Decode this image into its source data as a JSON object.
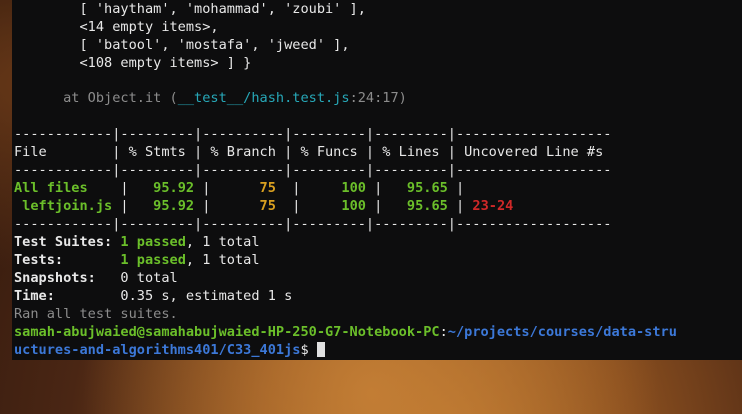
{
  "terminal": {
    "log_lines": [
      "        [ 'haytham', 'mohammad', 'zoubi' ],",
      "        <14 empty items>,",
      "        [ 'batool', 'mostafa', 'jweed' ],",
      "        <108 empty items> ] }"
    ],
    "stack_prefix": "      at Object.it (",
    "stack_path": "__test__/hash.test.js",
    "stack_suffix": ":24:17)",
    "coverage": {
      "separator": "------------|---------|----------|---------|---------|-------------------",
      "header": "File        | % Stmts | % Branch | % Funcs | % Lines | Uncovered Line #s ",
      "rows": [
        {
          "file": "All files   ",
          "stmts": "   95.92 ",
          "branch": "      75 ",
          "funcs": "     100 ",
          "lines": "   95.65 ",
          "uncovered": ""
        },
        {
          "file": " leftjoin.js",
          "stmts": "   95.92 ",
          "branch": "      75 ",
          "funcs": "     100 ",
          "lines": "   95.65 ",
          "uncovered": "23-24"
        }
      ]
    },
    "summary": {
      "suites_label": "Test Suites:",
      "suites_passed": "1 passed",
      "suites_total": ", 1 total",
      "tests_label": "Tests:      ",
      "tests_passed": "1 passed",
      "tests_total": ", 1 total",
      "snapshots_label": "Snapshots:  ",
      "snapshots_value": "0 total",
      "time_label": "Time:       ",
      "time_value": "0.35 s, estimated 1 s",
      "ran_all": "Ran all test suites."
    },
    "prompt": {
      "user_host": "samah-abujwaied@samahabujwaied-HP-250-G7-Notebook-PC",
      "colon": ":",
      "path_line1": "~/projects/courses/data-stru",
      "path_line2": "uctures-and-algorithms401/C33_401js",
      "symbol": "$ "
    }
  }
}
